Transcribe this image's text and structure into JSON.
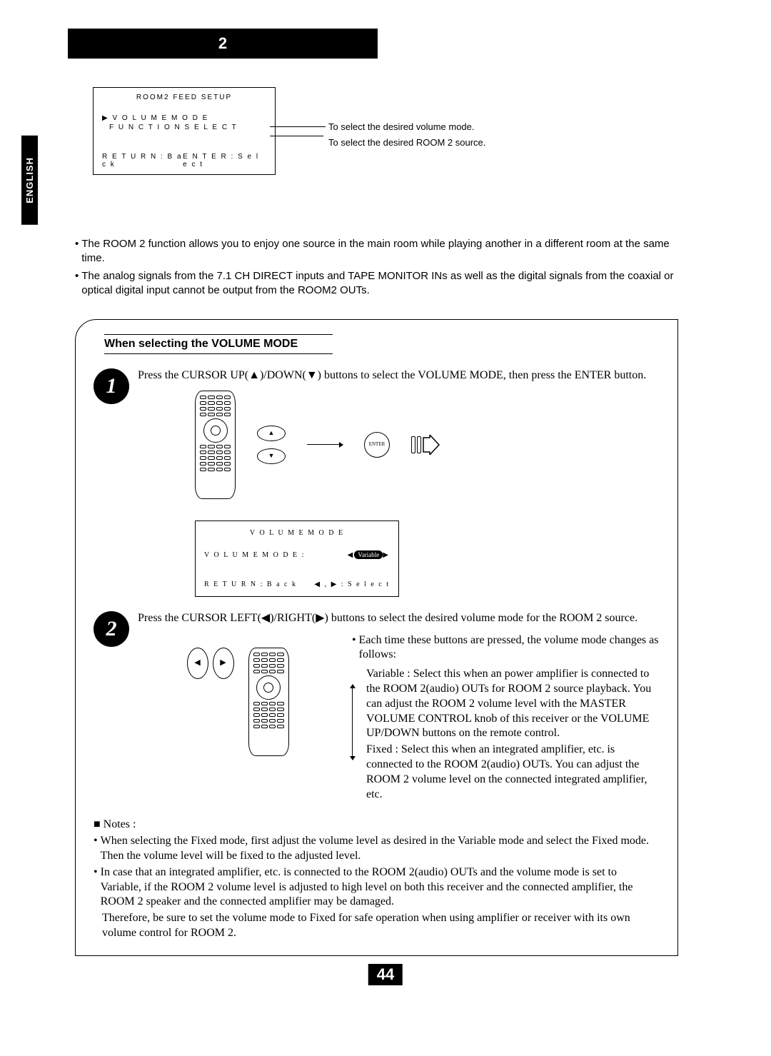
{
  "lang_tab": "ENGLISH",
  "title_num": "2",
  "setup_osd": {
    "title": "ROOM2 FEED SETUP",
    "item1": "▶ V O L U M E   M O D E",
    "item2": "F U N C T I O N   S E L E C T",
    "ret": "R E T U R N : B a c k",
    "ent": "E N T E R : S e l e c t"
  },
  "setup_labels": {
    "l1": "To select the desired volume mode.",
    "l2": "To select the desired ROOM 2 source."
  },
  "intro": {
    "b1": "The ROOM 2 function allows you to enjoy one source in the main room while playing another in a different room at the same time.",
    "b2": "The analog signals from the 7.1 CH DIRECT inputs  and TAPE MONITOR INs as well as the digital signals from the coaxial or optical digital input cannot be output from the ROOM2 OUTs."
  },
  "subhead": "When selecting the VOLUME MODE",
  "step1": {
    "num": "1",
    "text1": "Press the CURSOR UP(▲)/DOWN(▼) buttons to select the VOLUME MODE, then press the ENTER button.",
    "enter": "ENTER",
    "up": "▲",
    "down": "▼"
  },
  "osd_vol": {
    "title": "V O L U M E   M O D E",
    "label": "V O L U M E   M O D E     :",
    "value": "Variable",
    "ret": "R E T U R N : B a c k",
    "sel": "◀ , ▶ : S e l e c t"
  },
  "step2": {
    "num": "2",
    "text1": "Press the CURSOR LEFT(◀)/RIGHT(▶) buttons to select the desired volume mode for the ROOM 2 source.",
    "left": "◀",
    "right": "▶",
    "each": "Each time these buttons are pressed, the volume mode changes as follows:",
    "var_label": "Variable : ",
    "var_desc": "Select this when an power amplifier is connected to the ROOM 2(audio) OUTs for ROOM 2 source playback. You can adjust the ROOM 2 volume level with the MASTER VOLUME CONTROL knob of this receiver or the VOLUME UP/DOWN buttons on the remote control.",
    "fix_label": "Fixed : ",
    "fix_desc": "Select this when an integrated amplifier, etc. is connected to the ROOM 2(audio) OUTs. You can adjust the ROOM 2 volume level on the connected integrated amplifier, etc."
  },
  "notes": {
    "hdr": "■ Notes :",
    "n1": "When selecting the Fixed mode, first adjust the volume level as desired in the Variable mode and select the Fixed mode. Then the volume level will be fixed to the adjusted level.",
    "n2": "In case that an integrated amplifier, etc. is connected to the ROOM 2(audio) OUTs and the volume mode is set to Variable, if the ROOM 2 volume level is adjusted to high level on both this receiver and the connected amplifier, the ROOM 2 speaker and the connected amplifier may be damaged.",
    "n2b": "Therefore, be sure to set the volume mode to Fixed for safe operation when using amplifier or receiver with its own volume control for ROOM 2."
  },
  "page_num": "44"
}
